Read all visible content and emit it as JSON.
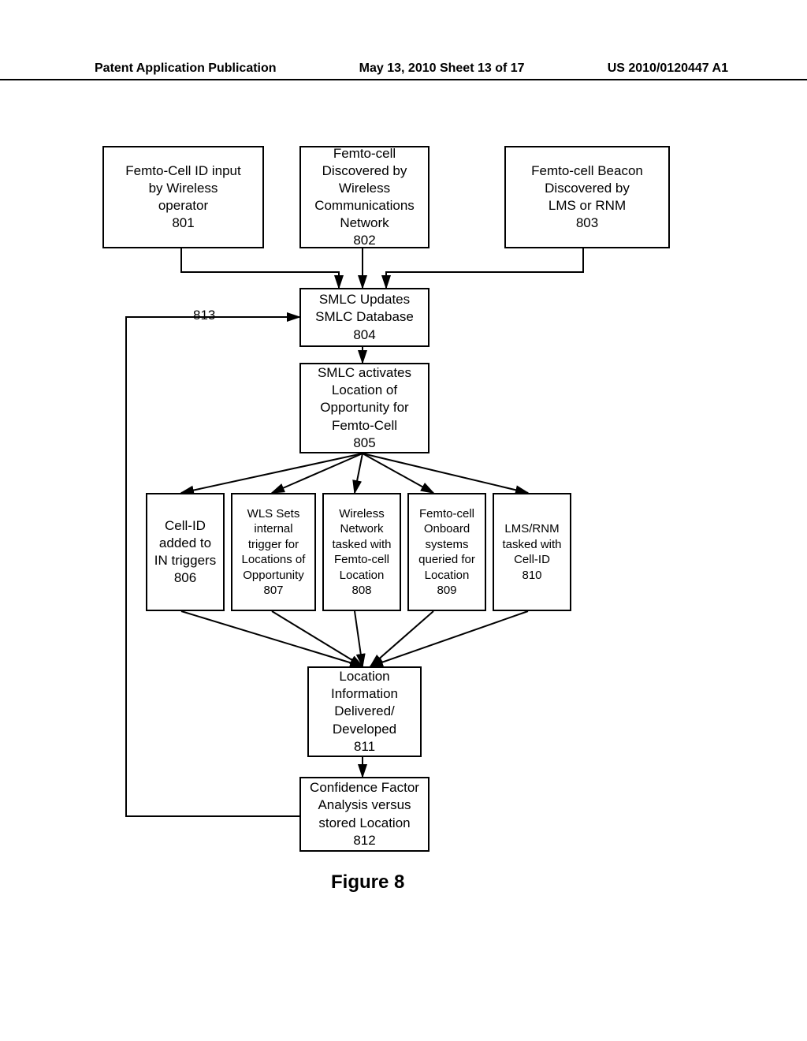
{
  "header": {
    "left": "Patent Application Publication",
    "center": "May 13, 2010  Sheet 13 of 17",
    "right": "US 2010/0120447 A1"
  },
  "boxes": {
    "b801": {
      "lines": [
        "Femto-Cell ID input",
        "by Wireless",
        "operator",
        "801"
      ]
    },
    "b802": {
      "lines": [
        "Femto-cell",
        "Discovered by",
        "Wireless",
        "Communications",
        "Network",
        "802"
      ]
    },
    "b803": {
      "lines": [
        "Femto-cell Beacon",
        "Discovered by",
        "LMS or RNM",
        "803"
      ]
    },
    "b804": {
      "lines": [
        "SMLC Updates",
        "SMLC Database",
        "804"
      ]
    },
    "b805": {
      "lines": [
        "SMLC activates",
        "Location of",
        "Opportunity for",
        "Femto-Cell",
        "805"
      ]
    },
    "b806": {
      "lines": [
        "Cell-ID",
        "added to",
        "IN triggers",
        "806"
      ]
    },
    "b807": {
      "lines": [
        "WLS Sets",
        "internal",
        "trigger for",
        "Locations of",
        "Opportunity",
        "807"
      ]
    },
    "b808": {
      "lines": [
        "Wireless",
        "Network",
        "tasked with",
        "Femto-cell",
        "Location",
        "808"
      ]
    },
    "b809": {
      "lines": [
        "Femto-cell",
        "Onboard",
        "systems",
        "queried for",
        "Location",
        "809"
      ]
    },
    "b810": {
      "lines": [
        "LMS/RNM",
        "tasked with",
        "Cell-ID",
        "810"
      ]
    },
    "b811": {
      "lines": [
        "Location",
        "Information",
        "Delivered/",
        "Developed",
        "811"
      ]
    },
    "b812": {
      "lines": [
        "Confidence Factor",
        "Analysis versus",
        "stored Location",
        "812"
      ]
    }
  },
  "labels": {
    "l813": "813"
  },
  "figure_caption": "Figure 8",
  "chart_data": {
    "type": "flowchart",
    "nodes": [
      {
        "id": "801",
        "label": "Femto-Cell ID input by Wireless operator"
      },
      {
        "id": "802",
        "label": "Femto-cell Discovered by Wireless Communications Network"
      },
      {
        "id": "803",
        "label": "Femto-cell Beacon Discovered by LMS or RNM"
      },
      {
        "id": "804",
        "label": "SMLC Updates SMLC Database"
      },
      {
        "id": "805",
        "label": "SMLC activates Location of Opportunity for Femto-Cell"
      },
      {
        "id": "806",
        "label": "Cell-ID added to IN triggers"
      },
      {
        "id": "807",
        "label": "WLS Sets internal trigger for Locations of Opportunity"
      },
      {
        "id": "808",
        "label": "Wireless Network tasked with Femto-cell Location"
      },
      {
        "id": "809",
        "label": "Femto-cell Onboard systems queried for Location"
      },
      {
        "id": "810",
        "label": "LMS/RNM tasked with Cell-ID"
      },
      {
        "id": "811",
        "label": "Location Information Delivered/ Developed"
      },
      {
        "id": "812",
        "label": "Confidence Factor Analysis versus stored Location"
      },
      {
        "id": "813",
        "label": "feedback loop"
      }
    ],
    "edges": [
      {
        "from": "801",
        "to": "804"
      },
      {
        "from": "802",
        "to": "804"
      },
      {
        "from": "803",
        "to": "804"
      },
      {
        "from": "804",
        "to": "805"
      },
      {
        "from": "805",
        "to": "806"
      },
      {
        "from": "805",
        "to": "807"
      },
      {
        "from": "805",
        "to": "808"
      },
      {
        "from": "805",
        "to": "809"
      },
      {
        "from": "805",
        "to": "810"
      },
      {
        "from": "806",
        "to": "811"
      },
      {
        "from": "807",
        "to": "811"
      },
      {
        "from": "808",
        "to": "811"
      },
      {
        "from": "809",
        "to": "811"
      },
      {
        "from": "810",
        "to": "811"
      },
      {
        "from": "811",
        "to": "812"
      },
      {
        "from": "812",
        "to": "804",
        "label": "813",
        "type": "feedback"
      }
    ]
  }
}
